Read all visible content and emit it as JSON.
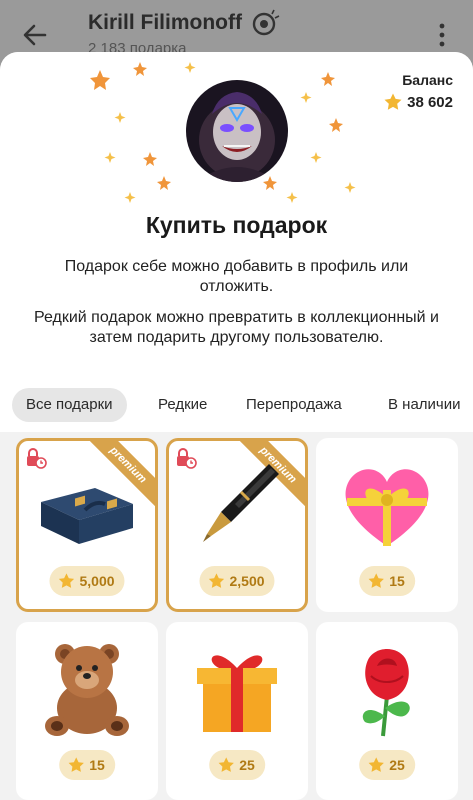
{
  "chat": {
    "name": "Kirill Filimonoff",
    "subtitle": "2 183 подарка"
  },
  "sheet": {
    "balance_label": "Баланс",
    "balance_value": "38 602",
    "title": "Купить подарок",
    "description_1": "Подарок себе можно добавить в профиль или отложить.",
    "description_2": "Редкий подарок можно превратить в коллекционный и затем подарить другому пользователю."
  },
  "tabs": [
    {
      "label": "Все подарки",
      "active": true
    },
    {
      "label": "Редкие",
      "active": false
    },
    {
      "label": "Перепродажа",
      "active": false
    },
    {
      "label": "В наличии",
      "active": false
    }
  ],
  "gifts": [
    {
      "item": "briefcase",
      "price": "5,000",
      "premium": true,
      "ribbon": "premium",
      "locked": true
    },
    {
      "item": "fountain-pen",
      "price": "2,500",
      "premium": true,
      "ribbon": "premium",
      "locked": true
    },
    {
      "item": "heart-with-ribbon",
      "price": "15",
      "premium": false
    },
    {
      "item": "teddy-bear",
      "price": "15",
      "premium": false
    },
    {
      "item": "gift-box",
      "price": "25",
      "premium": false
    },
    {
      "item": "rose",
      "price": "25",
      "premium": false
    }
  ],
  "colors": {
    "premium_border": "#d8a34b",
    "price_bg": "#f6e8c4",
    "price_text": "#b07a14",
    "star": "#f2b632"
  }
}
